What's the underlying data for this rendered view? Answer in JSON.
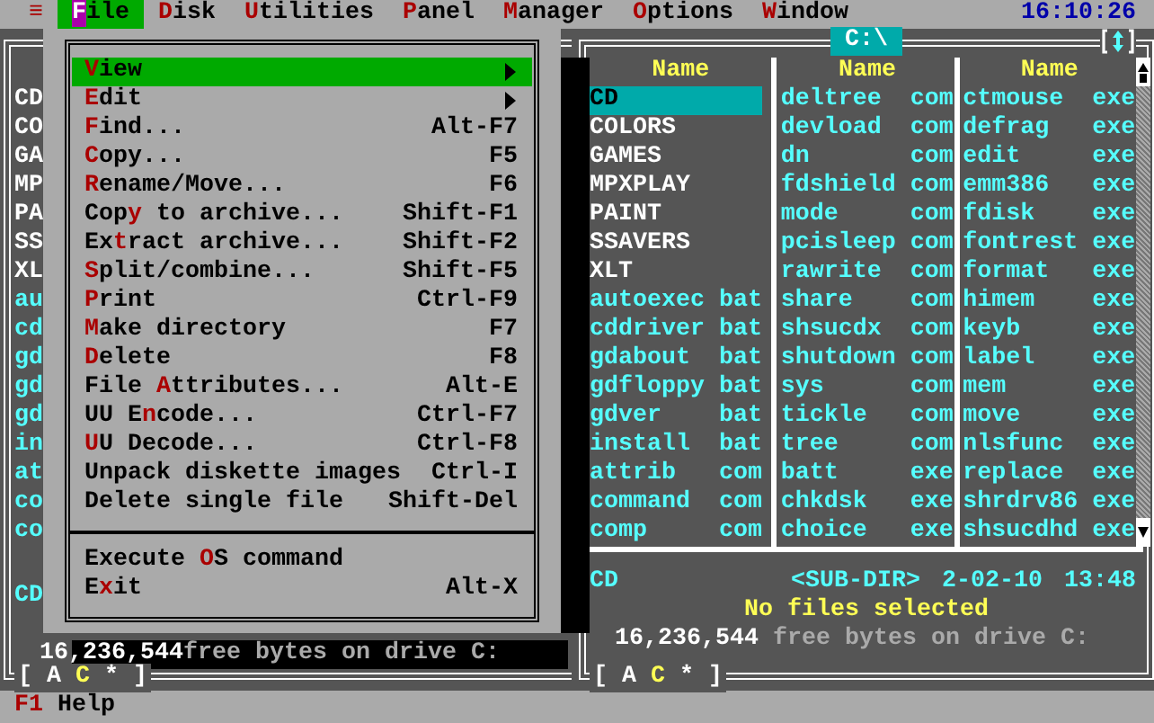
{
  "menu_bar": {
    "system_icon": "≡",
    "items": [
      {
        "key": "F",
        "rest": "ile",
        "selected": true
      },
      {
        "key": "D",
        "rest": "isk",
        "selected": false
      },
      {
        "key": "U",
        "rest": "tilities",
        "selected": false
      },
      {
        "key": "P",
        "rest": "anel",
        "selected": false
      },
      {
        "key": "M",
        "rest": "anager",
        "selected": false
      },
      {
        "key": "O",
        "rest": "ptions",
        "selected": false
      },
      {
        "key": "W",
        "rest": "indow",
        "selected": false
      }
    ],
    "clock": "16:10:26"
  },
  "file_menu": {
    "items": [
      {
        "kind": "item",
        "key": "V",
        "after": "iew",
        "submenu": true,
        "selected": true
      },
      {
        "kind": "item",
        "key": "E",
        "after": "dit",
        "submenu": true,
        "selected": false
      },
      {
        "kind": "item",
        "key": "F",
        "after": "ind...",
        "shortcut": "Alt-F7",
        "submenu": false,
        "selected": false
      },
      {
        "kind": "item",
        "key": "C",
        "after": "opy...",
        "shortcut": "F5",
        "submenu": false,
        "selected": false
      },
      {
        "kind": "item",
        "key": "R",
        "after": "ename/Move...",
        "shortcut": "F6",
        "submenu": false,
        "selected": false
      },
      {
        "kind": "item",
        "before": "Cop",
        "key": "y",
        "after": " to archive...",
        "shortcut": "Shift-F1",
        "submenu": false,
        "selected": false
      },
      {
        "kind": "item",
        "before": "Ex",
        "key": "t",
        "after": "ract archive...",
        "shortcut": "Shift-F2",
        "submenu": false,
        "selected": false
      },
      {
        "kind": "item",
        "key": "S",
        "after": "plit/combine...",
        "shortcut": "Shift-F5",
        "submenu": false,
        "selected": false
      },
      {
        "kind": "item",
        "key": "P",
        "after": "rint",
        "shortcut": "Ctrl-F9",
        "submenu": false,
        "selected": false
      },
      {
        "kind": "item",
        "key": "M",
        "after": "ake directory",
        "shortcut": "F7",
        "submenu": false,
        "selected": false
      },
      {
        "kind": "item",
        "key": "D",
        "after": "elete",
        "shortcut": "F8",
        "submenu": false,
        "selected": false
      },
      {
        "kind": "item",
        "before": "File ",
        "key": "A",
        "after": "ttributes...",
        "shortcut": "Alt-E",
        "submenu": false,
        "selected": false
      },
      {
        "kind": "item",
        "before": "UU E",
        "key": "n",
        "after": "code...",
        "shortcut": "Ctrl-F7",
        "submenu": false,
        "selected": false
      },
      {
        "kind": "item",
        "key": "U",
        "after": "U Decode...",
        "shortcut": "Ctrl-F8",
        "submenu": false,
        "selected": false
      },
      {
        "kind": "item",
        "before": "Unpack diskette images",
        "shortcut": "Ctrl-I",
        "submenu": false,
        "selected": false
      },
      {
        "kind": "item",
        "before": "Delete single file",
        "shortcut": "Shift-Del",
        "submenu": false,
        "selected": false
      },
      {
        "kind": "separator"
      },
      {
        "kind": "item",
        "before": "Execute ",
        "key": "O",
        "after": "S command",
        "submenu": false,
        "selected": false
      },
      {
        "kind": "item",
        "before": "E",
        "key": "x",
        "after": "it",
        "shortcut": "Alt-X",
        "submenu": false,
        "selected": false
      }
    ]
  },
  "left_panel": {
    "rows": [
      {
        "name": "CD",
        "kind": "dir"
      },
      {
        "name": "CO",
        "kind": "dir"
      },
      {
        "name": "GA",
        "kind": "dir"
      },
      {
        "name": "MP",
        "kind": "dir"
      },
      {
        "name": "PA",
        "kind": "dir"
      },
      {
        "name": "SS",
        "kind": "dir"
      },
      {
        "name": "XL",
        "kind": "dir"
      },
      {
        "name": "au",
        "kind": "file"
      },
      {
        "name": "cd",
        "kind": "file"
      },
      {
        "name": "gd",
        "kind": "file"
      },
      {
        "name": "gd",
        "kind": "file"
      },
      {
        "name": "gd",
        "kind": "file"
      },
      {
        "name": "in",
        "kind": "file"
      },
      {
        "name": "at",
        "kind": "file"
      },
      {
        "name": "co",
        "kind": "file"
      },
      {
        "name": "co",
        "kind": "file"
      }
    ],
    "current_name": "CD",
    "free_amount": "16,236,544",
    "free_text": "free bytes on drive C:",
    "drive_bar": {
      "open": "[",
      "close": "]",
      "drives": [
        {
          "label": "A",
          "selected": false
        },
        {
          "label": "C",
          "selected": true
        },
        {
          "label": "*",
          "selected": false
        }
      ]
    }
  },
  "right_panel": {
    "title": "C:\\",
    "columns": [
      {
        "header": "Name",
        "rows": [
          {
            "name": "CD",
            "kind": "dir",
            "selected": true
          },
          {
            "name": "COLORS",
            "kind": "dir",
            "selected": false
          },
          {
            "name": "GAMES",
            "kind": "dir",
            "selected": false
          },
          {
            "name": "MPXPLAY",
            "kind": "dir",
            "selected": false
          },
          {
            "name": "PAINT",
            "kind": "dir",
            "selected": false
          },
          {
            "name": "SSAVERS",
            "kind": "dir",
            "selected": false
          },
          {
            "name": "XLT",
            "kind": "dir",
            "selected": false
          },
          {
            "name": "autoexec",
            "ext": "bat",
            "kind": "file",
            "selected": false
          },
          {
            "name": "cddriver",
            "ext": "bat",
            "kind": "file",
            "selected": false
          },
          {
            "name": "gdabout",
            "ext": "bat",
            "kind": "file",
            "selected": false
          },
          {
            "name": "gdfloppy",
            "ext": "bat",
            "kind": "file",
            "selected": false
          },
          {
            "name": "gdver",
            "ext": "bat",
            "kind": "file",
            "selected": false
          },
          {
            "name": "install",
            "ext": "bat",
            "kind": "file",
            "selected": false
          },
          {
            "name": "attrib",
            "ext": "com",
            "kind": "file",
            "selected": false
          },
          {
            "name": "command",
            "ext": "com",
            "kind": "file",
            "selected": false
          },
          {
            "name": "comp",
            "ext": "com",
            "kind": "file",
            "selected": false
          }
        ]
      },
      {
        "header": "Name",
        "rows": [
          {
            "name": "deltree",
            "ext": "com",
            "kind": "file",
            "selected": false
          },
          {
            "name": "devload",
            "ext": "com",
            "kind": "file",
            "selected": false
          },
          {
            "name": "dn",
            "ext": "com",
            "kind": "file",
            "selected": false
          },
          {
            "name": "fdshield",
            "ext": "com",
            "kind": "file",
            "selected": false
          },
          {
            "name": "mode",
            "ext": "com",
            "kind": "file",
            "selected": false
          },
          {
            "name": "pcisleep",
            "ext": "com",
            "kind": "file",
            "selected": false
          },
          {
            "name": "rawrite",
            "ext": "com",
            "kind": "file",
            "selected": false
          },
          {
            "name": "share",
            "ext": "com",
            "kind": "file",
            "selected": false
          },
          {
            "name": "shsucdx",
            "ext": "com",
            "kind": "file",
            "selected": false
          },
          {
            "name": "shutdown",
            "ext": "com",
            "kind": "file",
            "selected": false
          },
          {
            "name": "sys",
            "ext": "com",
            "kind": "file",
            "selected": false
          },
          {
            "name": "tickle",
            "ext": "com",
            "kind": "file",
            "selected": false
          },
          {
            "name": "tree",
            "ext": "com",
            "kind": "file",
            "selected": false
          },
          {
            "name": "batt",
            "ext": "exe",
            "kind": "file",
            "selected": false
          },
          {
            "name": "chkdsk",
            "ext": "exe",
            "kind": "file",
            "selected": false
          },
          {
            "name": "choice",
            "ext": "exe",
            "kind": "file",
            "selected": false
          }
        ]
      },
      {
        "header": "Name",
        "rows": [
          {
            "name": "ctmouse",
            "ext": "exe",
            "kind": "file",
            "selected": false
          },
          {
            "name": "defrag",
            "ext": "exe",
            "kind": "file",
            "selected": false
          },
          {
            "name": "edit",
            "ext": "exe",
            "kind": "file",
            "selected": false
          },
          {
            "name": "emm386",
            "ext": "exe",
            "kind": "file",
            "selected": false
          },
          {
            "name": "fdisk",
            "ext": "exe",
            "kind": "file",
            "selected": false
          },
          {
            "name": "fontrest",
            "ext": "exe",
            "kind": "file",
            "selected": false
          },
          {
            "name": "format",
            "ext": "exe",
            "kind": "file",
            "selected": false
          },
          {
            "name": "himem",
            "ext": "exe",
            "kind": "file",
            "selected": false
          },
          {
            "name": "keyb",
            "ext": "exe",
            "kind": "file",
            "selected": false
          },
          {
            "name": "label",
            "ext": "exe",
            "kind": "file",
            "selected": false
          },
          {
            "name": "mem",
            "ext": "exe",
            "kind": "file",
            "selected": false
          },
          {
            "name": "move",
            "ext": "exe",
            "kind": "file",
            "selected": false
          },
          {
            "name": "nlsfunc",
            "ext": "exe",
            "kind": "file",
            "selected": false
          },
          {
            "name": "replace",
            "ext": "exe",
            "kind": "file",
            "selected": false
          },
          {
            "name": "shrdrv86",
            "ext": "exe",
            "kind": "file",
            "selected": false
          },
          {
            "name": "shsucdhd",
            "ext": "exe",
            "kind": "file",
            "selected": false
          }
        ]
      }
    ],
    "info": {
      "name": "CD",
      "type": "<SUB-DIR>",
      "date": "2-02-10",
      "time": "13:48"
    },
    "status": "No files selected",
    "free_amount": "16,236,544",
    "free_text": "free bytes on drive C:",
    "drive_bar": {
      "open": "[",
      "close": "]",
      "drives": [
        {
          "label": "A",
          "selected": false
        },
        {
          "label": "C",
          "selected": true
        },
        {
          "label": "*",
          "selected": false
        }
      ]
    }
  },
  "key_bar": {
    "items": [
      {
        "key": "F1",
        "label": "Help"
      }
    ]
  }
}
